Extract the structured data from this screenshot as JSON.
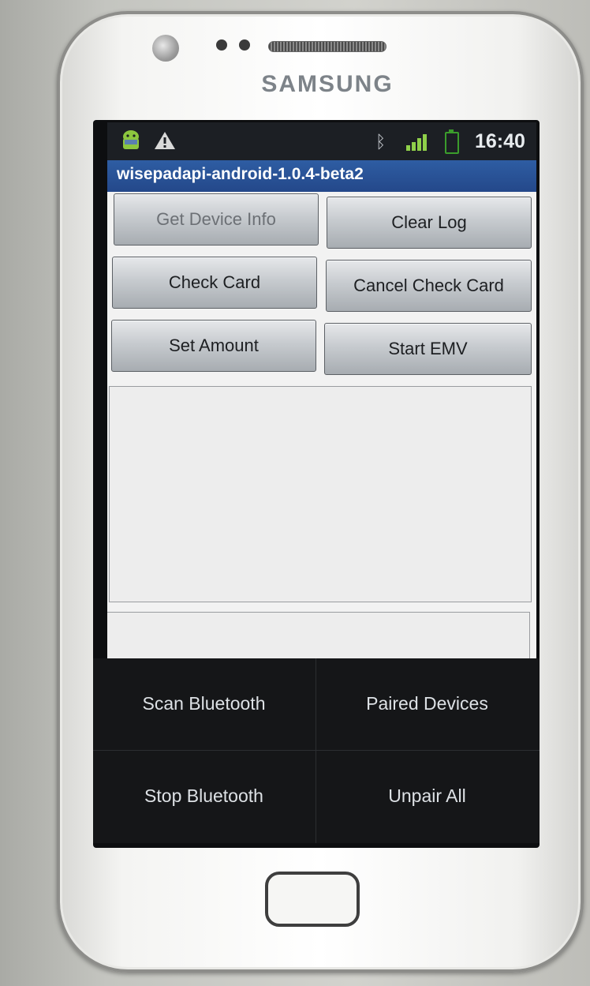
{
  "device": {
    "brand": "SAMSUNG"
  },
  "status_bar": {
    "time": "16:40",
    "icons": [
      "android-notification-icon",
      "warning-icon",
      "bluetooth-icon",
      "signal-icon",
      "battery-icon"
    ]
  },
  "app": {
    "title": "wisepadapi-android-1.0.4-beta2"
  },
  "buttons": {
    "get_device_info": "Get Device Info",
    "clear_log": "Clear Log",
    "check_card": "Check Card",
    "cancel_check_card": "Cancel Check Card",
    "set_amount": "Set Amount",
    "start_emv": "Start EMV"
  },
  "log_area": {
    "text": ""
  },
  "status_field": {
    "text": ""
  },
  "options_menu": {
    "items": [
      {
        "label": "Scan Bluetooth"
      },
      {
        "label": "Paired Devices"
      },
      {
        "label": "Stop Bluetooth"
      },
      {
        "label": "Unpair All"
      }
    ]
  },
  "colors": {
    "status_bar_bg": "#1c1f24",
    "title_bar_bg": "#2e5da3",
    "menu_bg": "#151618",
    "battery_green": "#3b9c2c"
  }
}
